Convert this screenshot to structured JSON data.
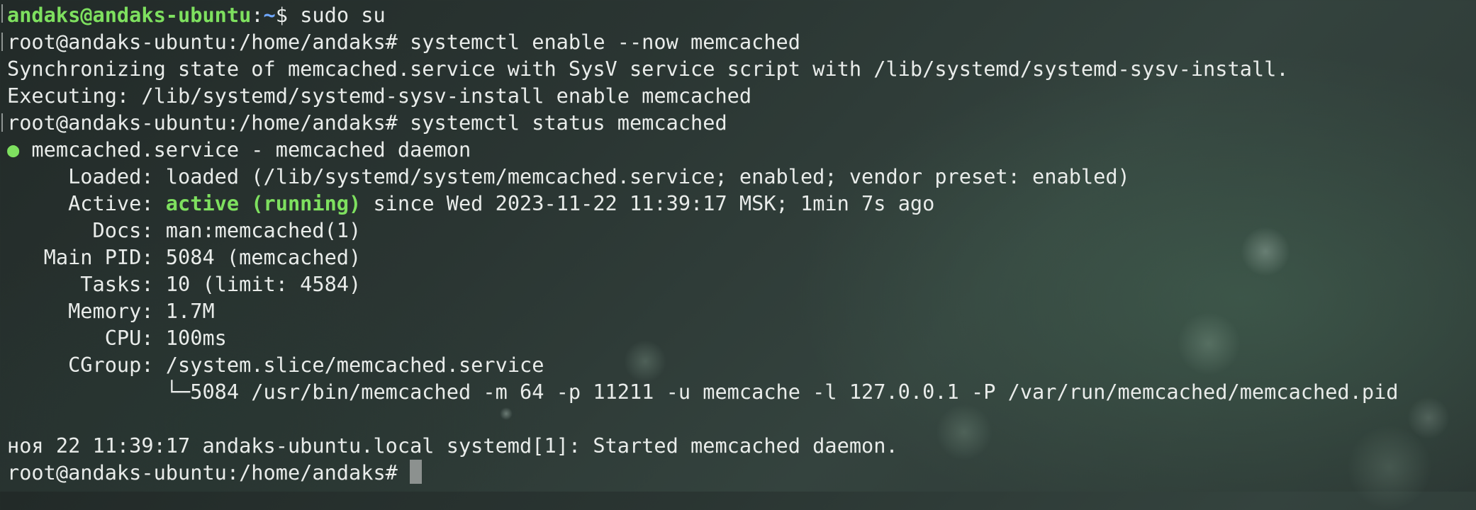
{
  "terminal": {
    "line1": {
      "user_host": "andaks@andaks-ubuntu",
      "colon": ":",
      "path": "~",
      "prompt_end": "$ ",
      "command": "sudo su"
    },
    "line2": {
      "prompt": "root@andaks-ubuntu:/home/andaks# ",
      "command": "systemctl enable --now memcached"
    },
    "line3": "Synchronizing state of memcached.service with SysV service script with /lib/systemd/systemd-sysv-install.",
    "line4": "Executing: /lib/systemd/systemd-sysv-install enable memcached",
    "line5": {
      "prompt": "root@andaks-ubuntu:/home/andaks# ",
      "command": "systemctl status memcached"
    },
    "line6": {
      "dot": "●",
      "text": " memcached.service - memcached daemon"
    },
    "line7": {
      "label": "     Loaded: ",
      "value": "loaded (/lib/systemd/system/memcached.service; enabled; vendor preset: enabled)"
    },
    "line8": {
      "label": "     Active: ",
      "state": "active (running)",
      "rest": " since Wed 2023-11-22 11:39:17 MSK; 1min 7s ago"
    },
    "line9": {
      "label": "       Docs: ",
      "value": "man:memcached(1)"
    },
    "line10": {
      "label": "   Main PID: ",
      "value": "5084 (memcached)"
    },
    "line11": {
      "label": "      Tasks: ",
      "value": "10 (limit: 4584)"
    },
    "line12": {
      "label": "     Memory: ",
      "value": "1.7M"
    },
    "line13": {
      "label": "        CPU: ",
      "value": "100ms"
    },
    "line14": {
      "label": "     CGroup: ",
      "value": "/system.slice/memcached.service"
    },
    "line15": "             └─5084 /usr/bin/memcached -m 64 -p 11211 -u memcache -l 127.0.0.1 -P /var/run/memcached/memcached.pid",
    "line17": "ноя 22 11:39:17 andaks-ubuntu.local systemd[1]: Started memcached daemon.",
    "line18": {
      "prompt": "root@andaks-ubuntu:/home/andaks# "
    }
  },
  "colors": {
    "prompt_green": "#7ee05f",
    "path_blue": "#6fa8ff",
    "text": "#e9ecea",
    "cursor": "#8c918f"
  }
}
